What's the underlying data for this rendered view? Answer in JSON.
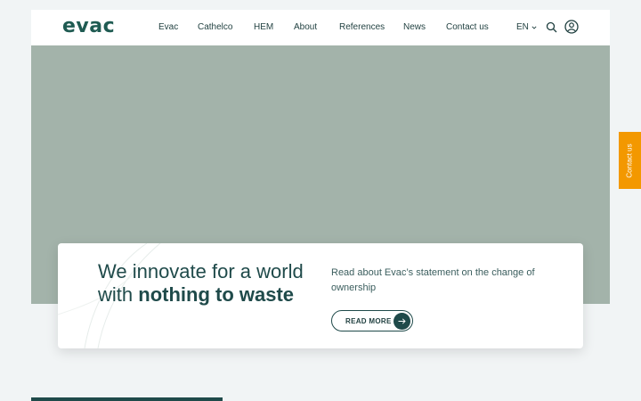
{
  "brand": {
    "logo": "evac",
    "logo_color": "#1f5b52"
  },
  "nav": {
    "items": [
      {
        "label": "Evac"
      },
      {
        "label": "Cathelco"
      },
      {
        "label": "HEM"
      },
      {
        "label": "About"
      },
      {
        "label": "References"
      },
      {
        "label": "News"
      },
      {
        "label": "Contact us"
      }
    ],
    "language": "EN",
    "icons": [
      "search-icon",
      "user-icon",
      "chevron-down-icon"
    ]
  },
  "hero": {
    "headline_part1": "We innovate for a world with ",
    "headline_bold": "nothing to waste",
    "statement": "Read about Evac’s statement on the change of ownership",
    "cta_label": "READ MORE",
    "background_color": "#a3b3aa"
  },
  "side_tab": {
    "label": "Contact us",
    "color": "#f39800"
  },
  "colors": {
    "primary": "#1f4a4a",
    "page_bg": "#f1f4f5"
  }
}
